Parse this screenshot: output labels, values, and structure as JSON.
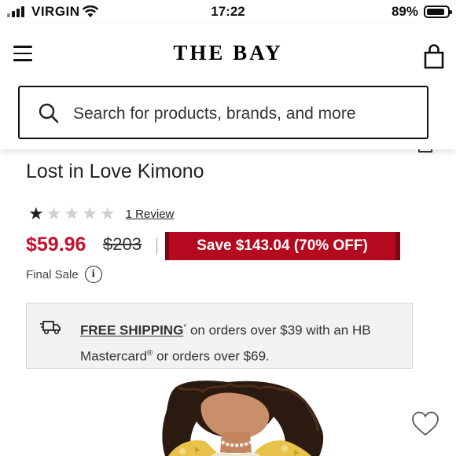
{
  "status_bar": {
    "carrier": "VIRGIN",
    "time": "17:22",
    "battery": "89%"
  },
  "header": {
    "logo": "THE BAY",
    "menu_icon": "hamburger-menu-icon",
    "bag_icon": "shopping-bag-icon"
  },
  "search": {
    "placeholder": "Search for products, brands, and more",
    "icon": "search-icon"
  },
  "product": {
    "title": "Lost in Love Kimono",
    "rating": 1,
    "rating_max": 5,
    "review_link": "1 Review",
    "sale_price": "$59.96",
    "original_price": "$203",
    "price_separator": "|",
    "savings": "Save $143.04 (70% OFF)",
    "final_sale": "Final Sale"
  },
  "shipping": {
    "link": "FREE SHIPPING",
    "asterisk": "*",
    "text_1": " on orders over $39 with an HB Mastercard",
    "registered": "®",
    "text_2": " or orders over $69.",
    "icon": "delivery-truck-icon"
  },
  "colors": {
    "sale_red": "#c4122f",
    "badge_red": "#b4091f",
    "shipping_bg": "#f2f2f2"
  }
}
